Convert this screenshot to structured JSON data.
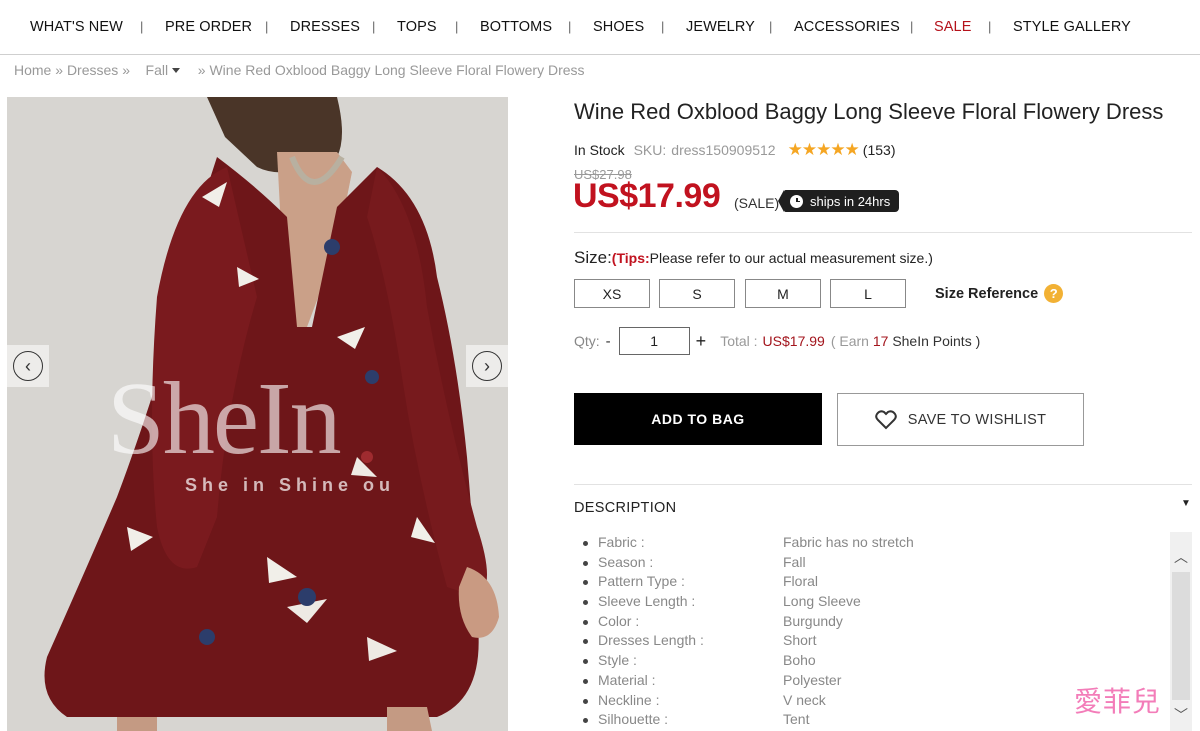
{
  "nav": {
    "items": [
      {
        "label": "WHAT'S NEW"
      },
      {
        "label": "PRE ORDER"
      },
      {
        "label": "DRESSES"
      },
      {
        "label": "TOPS"
      },
      {
        "label": "BOTTOMS"
      },
      {
        "label": "SHOES"
      },
      {
        "label": "JEWELRY"
      },
      {
        "label": "ACCESSORIES"
      },
      {
        "label": "SALE"
      },
      {
        "label": "STYLE GALLERY"
      }
    ],
    "separator": "|",
    "sale_color": "#b5121b"
  },
  "breadcrumb": {
    "home": "Home",
    "sep1": "»",
    "dresses": "Dresses",
    "sep2": "»",
    "season": "Fall",
    "sep3": "»",
    "current": "Wine Red Oxblood Baggy Long Sleeve Floral Flowery Dress"
  },
  "gallery": {
    "watermark": "SheIn",
    "watermark_tagline": "She in  Shine ou",
    "prev_icon": "chevron-left-icon",
    "next_icon": "chevron-right-icon",
    "prev_glyph": "‹",
    "next_glyph": "›"
  },
  "product": {
    "title": "Wine Red Oxblood Baggy Long Sleeve Floral Flowery Dress",
    "stock": "In Stock",
    "sku_label": "SKU:",
    "sku": "dress150909512",
    "stars": "★★★★★",
    "rating_value": 5,
    "reviews": "(153)",
    "old_price": "US$27.98",
    "price": "US$17.99",
    "sale_tag": "(SALE)",
    "ships_badge": "ships in 24hrs",
    "price_color": "#c1121f"
  },
  "size": {
    "label": "Size:",
    "tips_label": "(Tips:",
    "tips_text": "Please refer to our actual measurement size.)",
    "options": [
      "XS",
      "S",
      "M",
      "L"
    ],
    "reference": "Size Reference",
    "reference_icon": "?"
  },
  "qty": {
    "label": "Qty:",
    "minus": "-",
    "value": "1",
    "plus": "+",
    "total_label": "Total :",
    "total_value": "US$17.99",
    "earn_open": "( Earn",
    "earn_points": "17",
    "earn_close": "SheIn Points )"
  },
  "actions": {
    "add_to_bag": "ADD TO BAG",
    "save_wishlist": "SAVE TO WISHLIST"
  },
  "description": {
    "title": "DESCRIPTION",
    "toggle": "▼",
    "rows": [
      {
        "key": "Fabric :",
        "value": "Fabric has no stretch"
      },
      {
        "key": "Season :",
        "value": "Fall"
      },
      {
        "key": "Pattern Type :",
        "value": "Floral"
      },
      {
        "key": "Sleeve Length :",
        "value": "Long Sleeve"
      },
      {
        "key": "Color :",
        "value": "Burgundy"
      },
      {
        "key": "Dresses Length :",
        "value": "Short"
      },
      {
        "key": "Style :",
        "value": "Boho"
      },
      {
        "key": "Material :",
        "value": "Polyester"
      },
      {
        "key": "Neckline :",
        "value": "V neck"
      },
      {
        "key": "Silhouette :",
        "value": "Tent"
      }
    ]
  },
  "scroll": {
    "up": "︿",
    "down": "﹀"
  },
  "corner_logo": "愛菲兒"
}
